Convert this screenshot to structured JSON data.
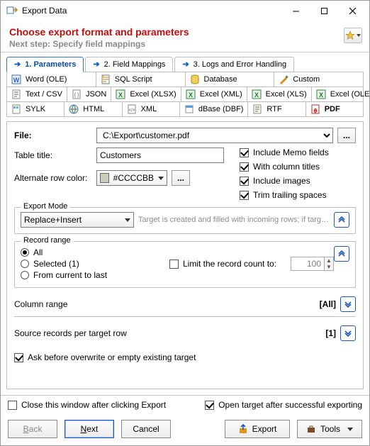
{
  "window": {
    "title": "Export Data"
  },
  "header": {
    "title": "Choose export format and parameters",
    "subtitle": "Next step: Specify field mappings"
  },
  "steps": {
    "items": [
      {
        "label": "1. Parameters"
      },
      {
        "label": "2. Field Mappings"
      },
      {
        "label": "3. Logs and Error Handling"
      }
    ]
  },
  "formats": {
    "row1": [
      {
        "label": "Word (OLE)"
      },
      {
        "label": "SQL Script"
      },
      {
        "label": "Database"
      },
      {
        "label": "Custom"
      }
    ],
    "row2": [
      {
        "label": "Text / CSV"
      },
      {
        "label": "JSON"
      },
      {
        "label": "Excel (XLSX)"
      },
      {
        "label": "Excel (XML)"
      },
      {
        "label": "Excel (XLS)"
      },
      {
        "label": "Excel (OLE)"
      }
    ],
    "row3": [
      {
        "label": "SYLK"
      },
      {
        "label": "HTML"
      },
      {
        "label": "XML"
      },
      {
        "label": "dBase (DBF)"
      },
      {
        "label": "RTF"
      },
      {
        "label": "PDF"
      }
    ]
  },
  "file": {
    "label": "File:",
    "value": "C:\\Export\\customer.pdf",
    "browse": "..."
  },
  "tableTitle": {
    "label": "Table title:",
    "value": "Customers"
  },
  "altColor": {
    "label": "Alternate row color:",
    "value": "#CCCCBB",
    "more": "..."
  },
  "options": {
    "memo": "Include Memo fields",
    "titles": "With column titles",
    "images": "Include images",
    "trim": "Trim trailing spaces"
  },
  "exportMode": {
    "legend": "Export Mode",
    "value": "Replace+Insert",
    "hint": "Target is created and filled with incoming rows; if target..."
  },
  "recordRange": {
    "legend": "Record range",
    "all": "All",
    "selected": "Selected (1)",
    "current": "From current to last",
    "limitLabel": "Limit the record count to:",
    "limitValue": "100"
  },
  "columnRange": {
    "label": "Column range",
    "value": "[All]"
  },
  "sourceRows": {
    "label": "Source records per target row",
    "value": "[1]"
  },
  "askOverwrite": "Ask before overwrite or empty existing target",
  "bottomOpts": {
    "closeAfter": "Close this window after clicking Export",
    "openTarget": "Open target after successful exporting"
  },
  "buttons": {
    "back": "Back",
    "next": "Next",
    "cancel": "Cancel",
    "export": "Export",
    "tools": "Tools"
  }
}
